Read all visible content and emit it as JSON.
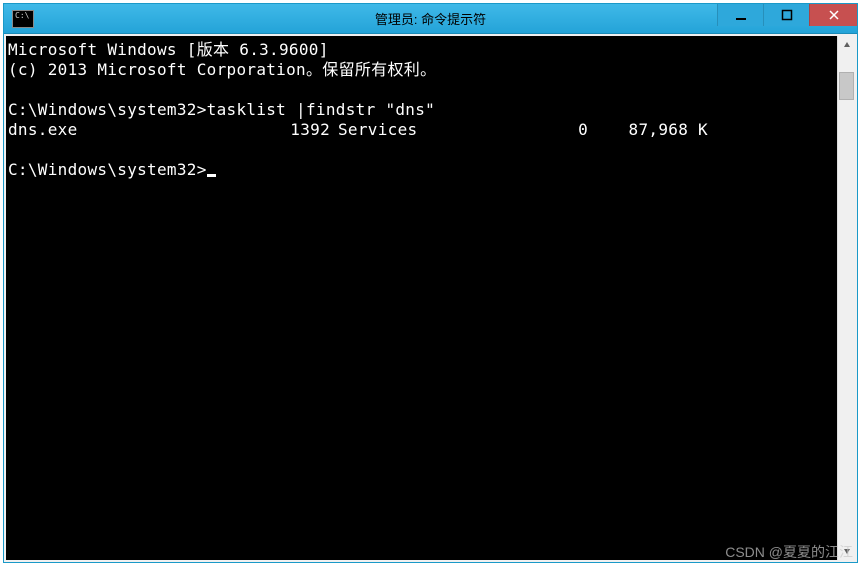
{
  "window": {
    "title": "管理员: 命令提示符",
    "icon_label": "C:\\"
  },
  "terminal": {
    "banner_line1": "Microsoft Windows [版本 6.3.9600]",
    "banner_line2": "(c) 2013 Microsoft Corporation。保留所有权利。",
    "prompt1_path": "C:\\Windows\\system32>",
    "prompt1_cmd": "tasklist |findstr \"dns\"",
    "output": {
      "name": "dns.exe",
      "pid": "1392",
      "session": "Services",
      "session_num": "0",
      "mem": "87,968 K"
    },
    "prompt2_path": "C:\\Windows\\system32>"
  },
  "watermark": "CSDN @夏夏的江江"
}
